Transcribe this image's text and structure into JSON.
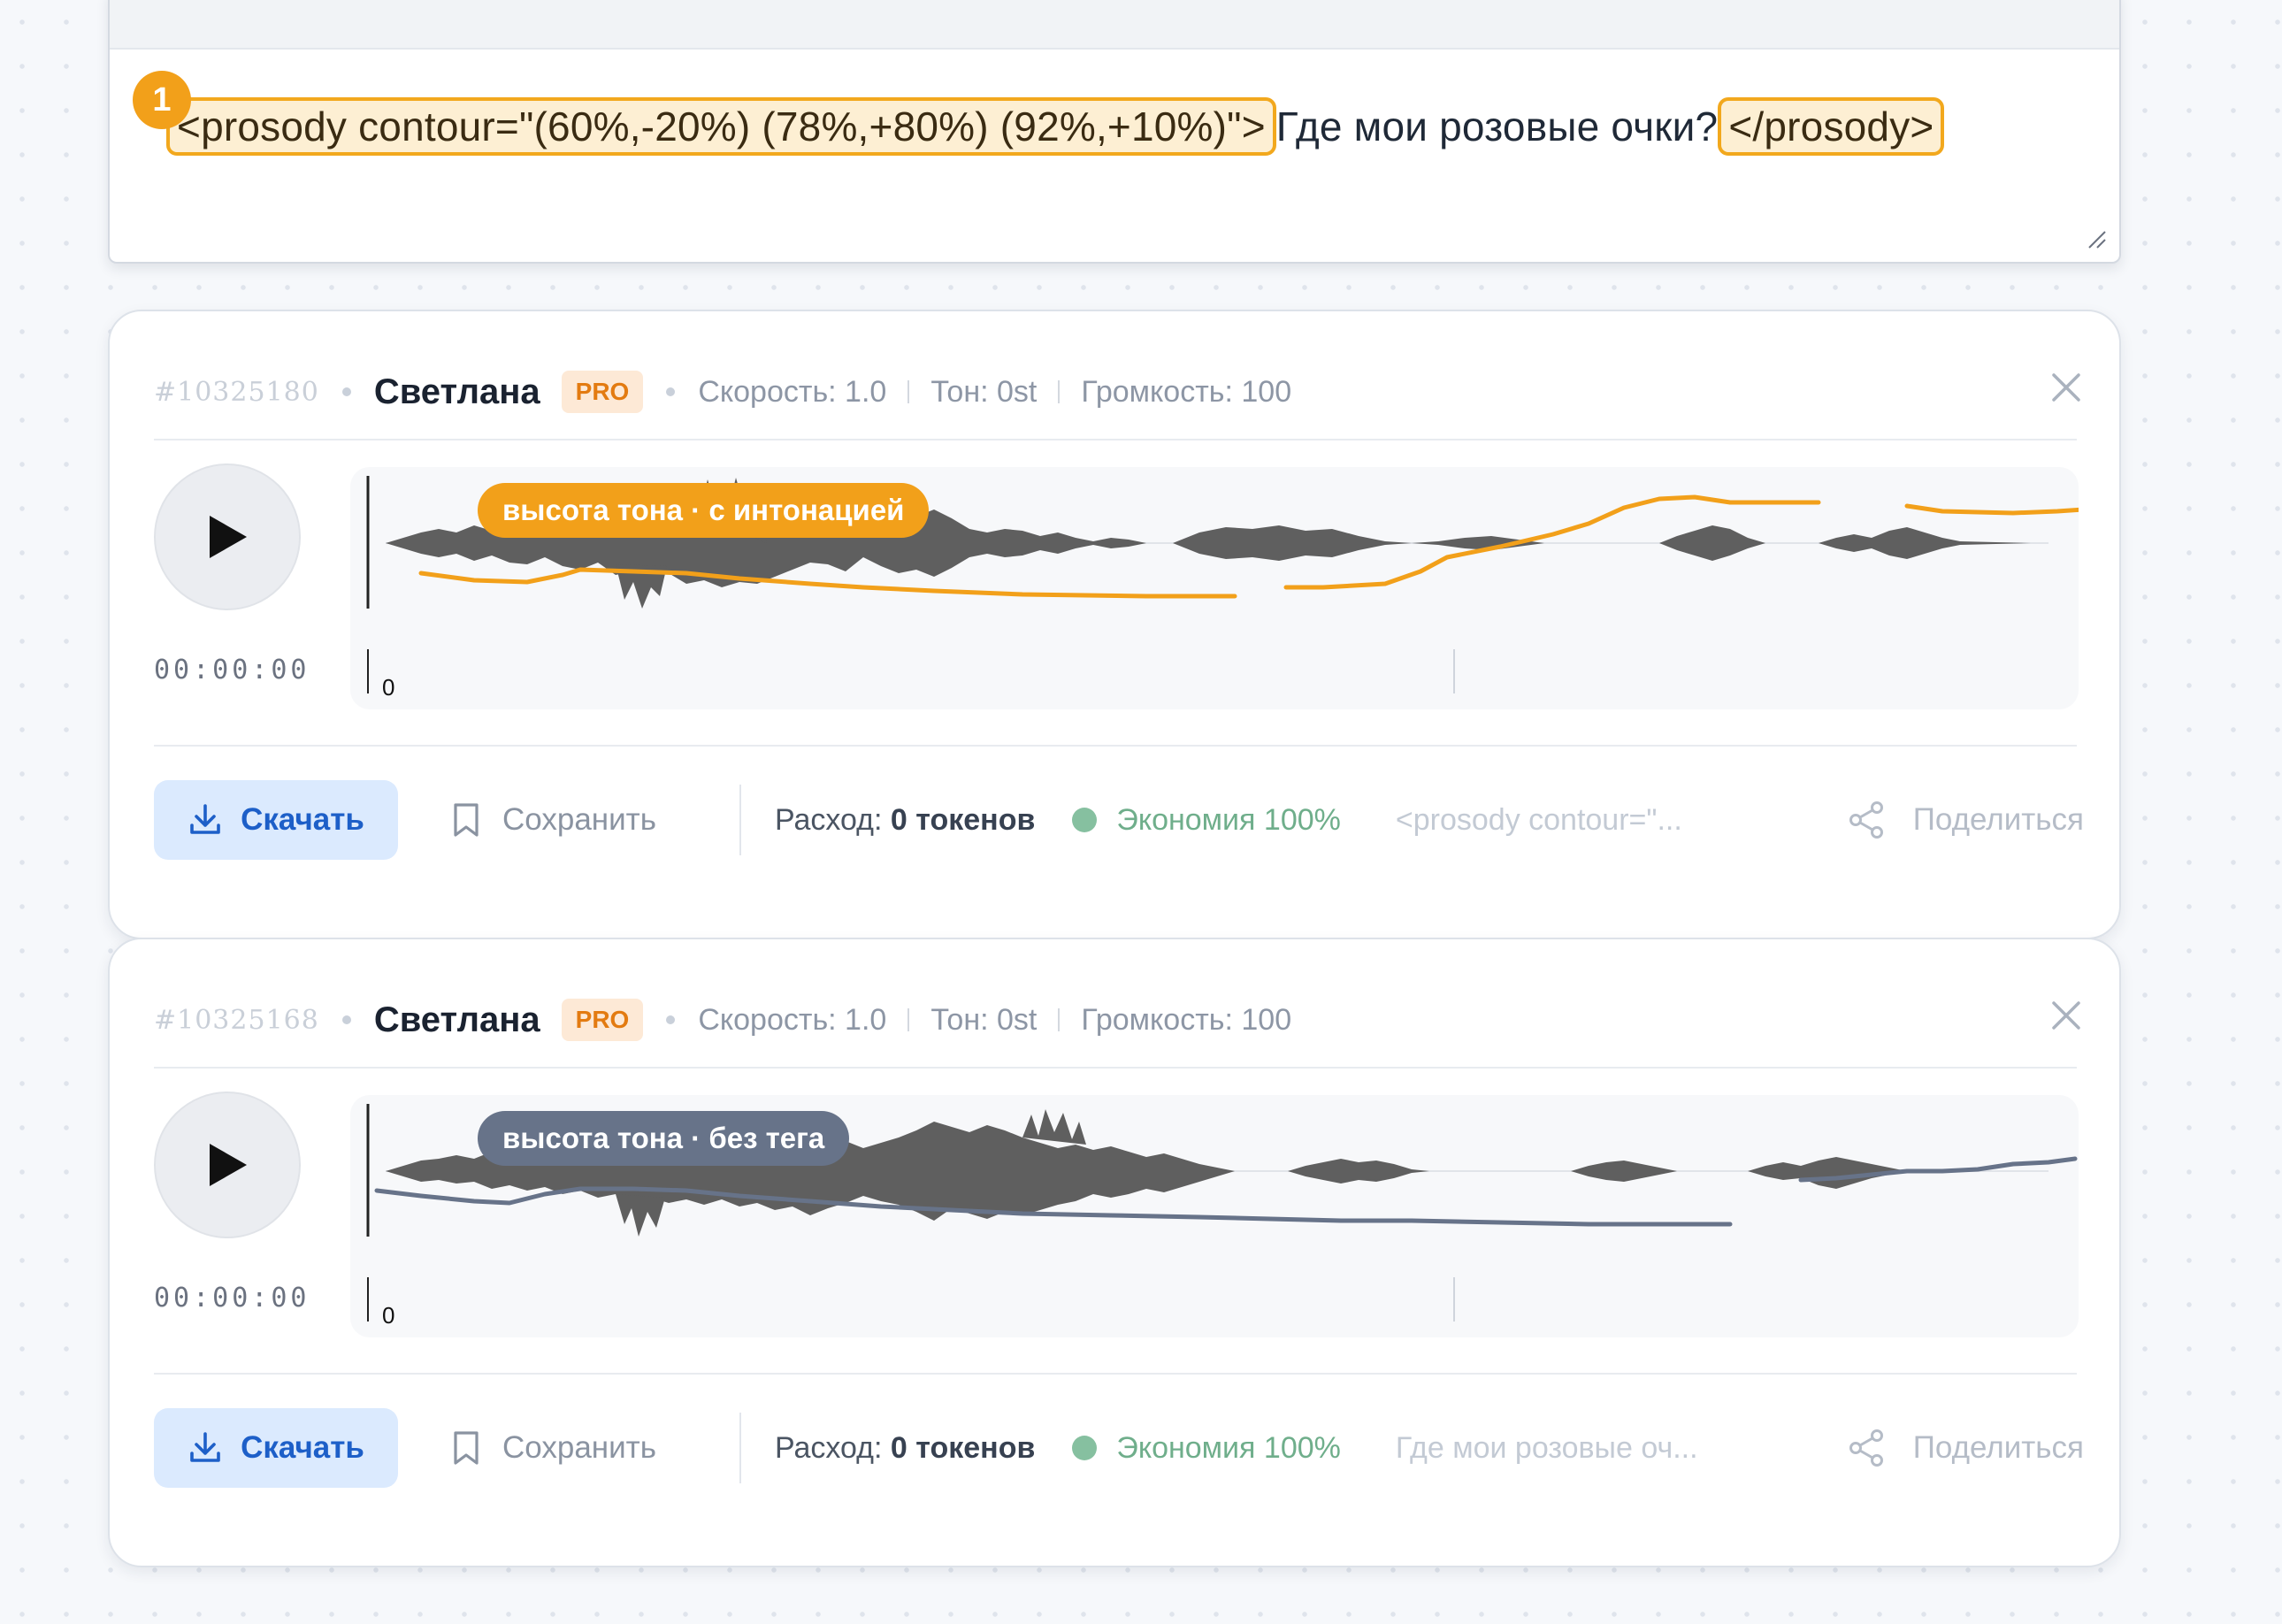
{
  "editor": {
    "step_number": "1",
    "open_tag": "<prosody contour=\"(60%,-20%) (78%,+80%) (92%,+10%)\">",
    "text": "Где мои розовые очки?",
    "close_tag": "</prosody>"
  },
  "cards": [
    {
      "id": "#10325180",
      "voice": "Светлана",
      "badge": "PRO",
      "speed": "Скорость: 1.0",
      "tone": "Тон: 0st",
      "volume": "Громкость: 100",
      "timecode": "00:00:00",
      "axis_zero": "0",
      "pitch_label": "высота тона · с интонацией",
      "pitch_color": "#f2a01a",
      "download_label": "Скачать",
      "save_label": "Сохранить",
      "spend_prefix": "Расход:",
      "spend_value": "0 токенов",
      "savings": "Экономия 100%",
      "text_preview": "<prosody contour=\"...",
      "share_label": "Поделиться"
    },
    {
      "id": "#10325168",
      "voice": "Светлана",
      "badge": "PRO",
      "speed": "Скорость: 1.0",
      "tone": "Тон: 0st",
      "volume": "Громкость: 100",
      "timecode": "00:00:00",
      "axis_zero": "0",
      "pitch_label": "высота тона · без тега",
      "pitch_color": "#677389",
      "download_label": "Скачать",
      "save_label": "Сохранить",
      "spend_prefix": "Расход:",
      "spend_value": "0 токенов",
      "savings": "Экономия 100%",
      "text_preview": "Где мои розовые оч...",
      "share_label": "Поделиться"
    }
  ],
  "colors": {
    "accent_orange": "#f2a01a",
    "download_blue": "#1d5fc8",
    "savings_green": "#6fae8b",
    "waveform_gray": "#5f5f5f"
  },
  "icons": [
    "play-icon",
    "download-icon",
    "bookmark-icon",
    "share-icon",
    "close-icon"
  ]
}
